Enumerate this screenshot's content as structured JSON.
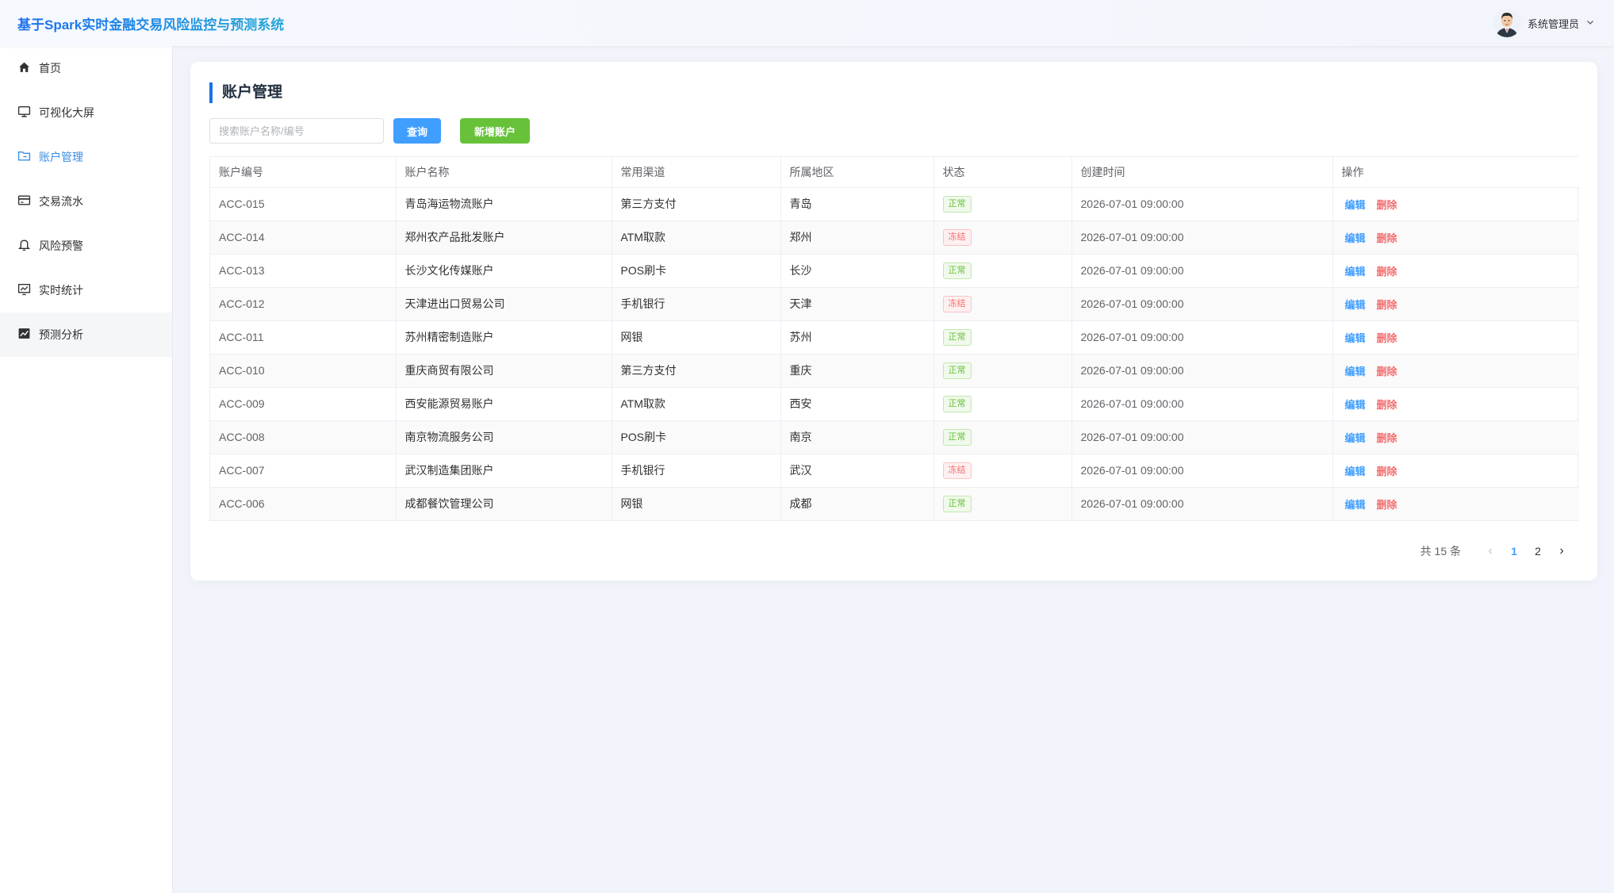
{
  "app": {
    "title": "基于Spark实时金融交易风险监控与预测系统",
    "user_name": "系统管理员"
  },
  "sidebar": {
    "items": [
      {
        "label": "首页",
        "icon": "home-icon"
      },
      {
        "label": "可视化大屏",
        "icon": "monitor-icon"
      },
      {
        "label": "账户管理",
        "icon": "folder-icon",
        "active": true
      },
      {
        "label": "交易流水",
        "icon": "credit-card-icon"
      },
      {
        "label": "风险预警",
        "icon": "bell-icon"
      },
      {
        "label": "实时统计",
        "icon": "chart-icon"
      },
      {
        "label": "预测分析",
        "icon": "trend-chart-icon",
        "hovered": true
      }
    ]
  },
  "page": {
    "title": "账户管理",
    "search_placeholder": "搜索账户名称/编号",
    "query_label": "查询",
    "add_label": "新增账户"
  },
  "table": {
    "columns": [
      "账户编号",
      "账户名称",
      "常用渠道",
      "所属地区",
      "状态",
      "创建时间",
      "操作"
    ],
    "rows": [
      {
        "code": "ACC-015",
        "name": "青岛海运物流账户",
        "channel": "第三方支付",
        "region": "青岛",
        "status": "正常",
        "status_type": "normal",
        "created": "2026-07-01 09:00:00"
      },
      {
        "code": "ACC-014",
        "name": "郑州农产品批发账户",
        "channel": "ATM取款",
        "region": "郑州",
        "status": "冻结",
        "status_type": "frozen",
        "created": "2026-07-01 09:00:00"
      },
      {
        "code": "ACC-013",
        "name": "长沙文化传媒账户",
        "channel": "POS刷卡",
        "region": "长沙",
        "status": "正常",
        "status_type": "normal",
        "created": "2026-07-01 09:00:00"
      },
      {
        "code": "ACC-012",
        "name": "天津进出口贸易公司",
        "channel": "手机银行",
        "region": "天津",
        "status": "冻结",
        "status_type": "frozen",
        "created": "2026-07-01 09:00:00"
      },
      {
        "code": "ACC-011",
        "name": "苏州精密制造账户",
        "channel": "网银",
        "region": "苏州",
        "status": "正常",
        "status_type": "normal",
        "created": "2026-07-01 09:00:00"
      },
      {
        "code": "ACC-010",
        "name": "重庆商贸有限公司",
        "channel": "第三方支付",
        "region": "重庆",
        "status": "正常",
        "status_type": "normal",
        "created": "2026-07-01 09:00:00"
      },
      {
        "code": "ACC-009",
        "name": "西安能源贸易账户",
        "channel": "ATM取款",
        "region": "西安",
        "status": "正常",
        "status_type": "normal",
        "created": "2026-07-01 09:00:00"
      },
      {
        "code": "ACC-008",
        "name": "南京物流服务公司",
        "channel": "POS刷卡",
        "region": "南京",
        "status": "正常",
        "status_type": "normal",
        "created": "2026-07-01 09:00:00"
      },
      {
        "code": "ACC-007",
        "name": "武汉制造集团账户",
        "channel": "手机银行",
        "region": "武汉",
        "status": "冻结",
        "status_type": "frozen",
        "created": "2026-07-01 09:00:00"
      },
      {
        "code": "ACC-006",
        "name": "成都餐饮管理公司",
        "channel": "网银",
        "region": "成都",
        "status": "正常",
        "status_type": "normal",
        "created": "2026-07-01 09:00:00"
      }
    ],
    "actions": {
      "edit": "编辑",
      "delete": "删除"
    }
  },
  "pagination": {
    "total_text": "共 15 条",
    "pages": [
      "1",
      "2"
    ],
    "current": "1"
  },
  "colors": {
    "primary": "#409eff",
    "success": "#67c23a",
    "danger": "#f56c6c",
    "accent_bar": "#1a73e8"
  }
}
